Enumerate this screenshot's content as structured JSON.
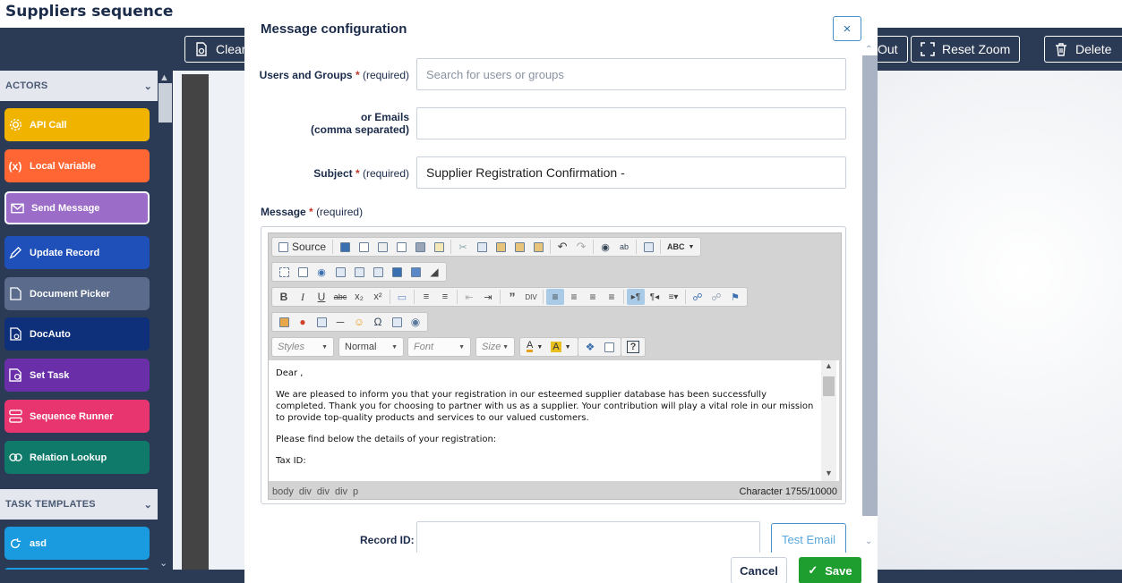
{
  "app": {
    "title": "Suppliers sequence",
    "toolbar": {
      "clear_label": "Clear",
      "zoom_out_label": "Out",
      "reset_zoom_label": "Reset Zoom",
      "delete_label": "Delete"
    }
  },
  "sidebar": {
    "actors_header": "ACTORS",
    "actors": [
      {
        "label": "API Call",
        "icon": "gear-icon",
        "color": "#f0b400"
      },
      {
        "label": "Local Variable",
        "icon": "variable-icon",
        "color": "#ff6633"
      },
      {
        "label": "Send Message",
        "icon": "envelope-icon",
        "color": "#9b6cc8"
      },
      {
        "label": "Update Record",
        "icon": "pencil-icon",
        "color": "#1f4fb8"
      },
      {
        "label": "Document Picker",
        "icon": "document-icon",
        "color": "#5a6b8c"
      },
      {
        "label": "DocAuto",
        "icon": "doc-auto-icon",
        "color": "#0e2f7a"
      },
      {
        "label": "Set Task",
        "icon": "task-icon",
        "color": "#6a2fa8"
      },
      {
        "label": "Sequence Runner",
        "icon": "sequence-icon",
        "color": "#e8356f"
      },
      {
        "label": "Relation Lookup",
        "icon": "relation-icon",
        "color": "#0f7a6a"
      }
    ],
    "templates_header": "TASK TEMPLATES",
    "templates": [
      {
        "label": "asd",
        "icon": "refresh-icon",
        "color": "#1a9be0"
      }
    ]
  },
  "modal": {
    "title": "Message configuration",
    "close_symbol": "×",
    "users_label": "Users and Groups",
    "users_placeholder": "Search for users or groups",
    "emails_label_line1": "or Emails",
    "emails_label_line2": "(comma separated)",
    "emails_value": "",
    "subject_label": "Subject",
    "subject_value": "Supplier Registration Confirmation -",
    "required_mark": "*",
    "required_text": "(required)",
    "message_label": "Message",
    "editor": {
      "source_label": "Source",
      "combos": {
        "styles": "Styles",
        "format": "Normal",
        "font": "Font",
        "size": "Size"
      },
      "body": [
        "Dear ,",
        "We are pleased to inform you that your registration in our esteemed supplier database has been successfully completed. Thank you for choosing to partner with us as a supplier. Your contribution will play a vital role in our mission to provide top-quality products and services to our valued customers.",
        "Please find below the details of your registration:",
        "Tax ID:"
      ],
      "path": [
        "body",
        "div",
        "div",
        "div",
        "p"
      ],
      "char_count": "Character 1755/10000"
    },
    "record_label": "Record ID:",
    "test_email_label": "Test Email",
    "cancel_label": "Cancel",
    "save_label": "Save"
  }
}
